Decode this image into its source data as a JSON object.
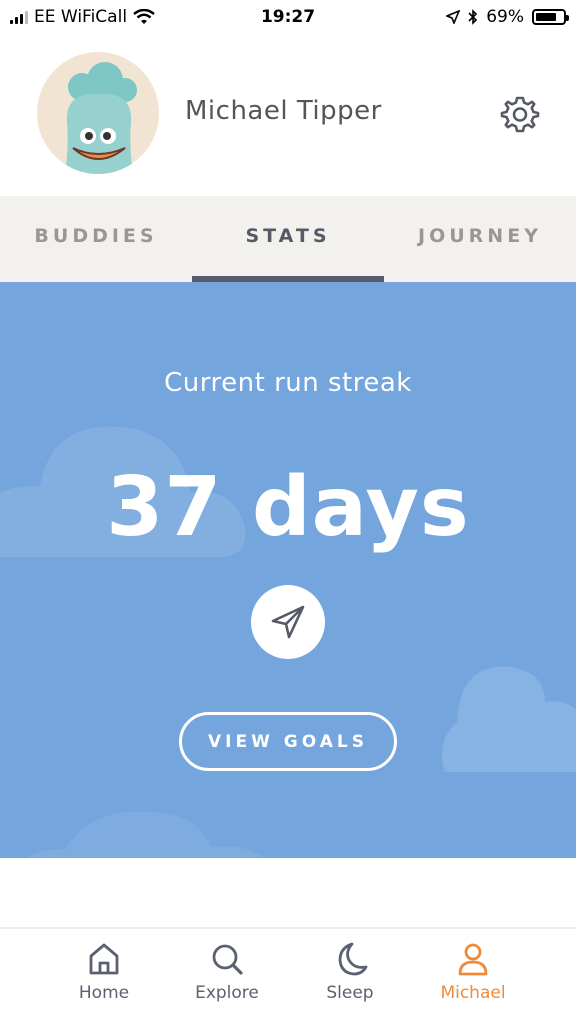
{
  "status_bar": {
    "carrier": "EE WiFiCall",
    "time": "19:27",
    "battery": "69%"
  },
  "profile": {
    "name": "Michael Tipper"
  },
  "tabs": [
    {
      "label": "BUDDIES",
      "active": false
    },
    {
      "label": "STATS",
      "active": true
    },
    {
      "label": "JOURNEY",
      "active": false
    }
  ],
  "stats": {
    "streak_label": "Current run streak",
    "streak_value": "37 days",
    "view_goals_label": "VIEW GOALS"
  },
  "bottom_nav": [
    {
      "label": "Home",
      "icon": "home-icon"
    },
    {
      "label": "Explore",
      "icon": "search-icon"
    },
    {
      "label": "Sleep",
      "icon": "moon-icon"
    },
    {
      "label": "Michael",
      "icon": "person-icon",
      "active": true
    }
  ],
  "colors": {
    "panel_blue": "#74a5dc",
    "accent_orange": "#ef8a3a",
    "tab_indicator": "#565b6e"
  }
}
